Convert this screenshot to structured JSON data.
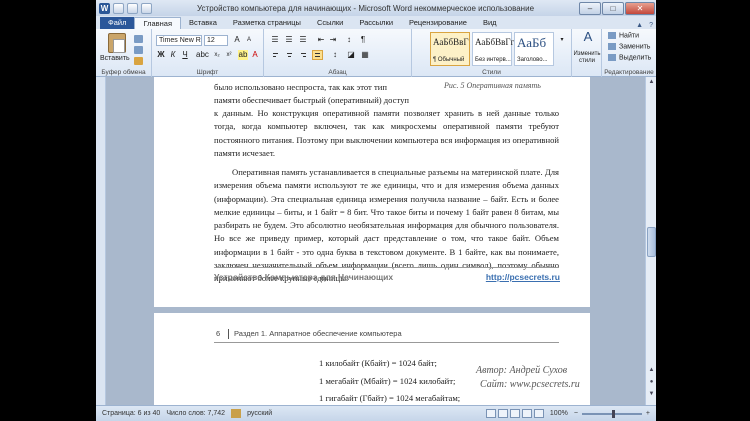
{
  "window": {
    "title": "Устройство компьютера для начинающих - Microsoft Word некоммерческое использование",
    "minimize": "–",
    "maximize": "□",
    "close": "✕"
  },
  "tabs": [
    "Файл",
    "Главная",
    "Вставка",
    "Разметка страницы",
    "Ссылки",
    "Рассылки",
    "Рецензирование",
    "Вид"
  ],
  "ribbon": {
    "clipboard": {
      "paste_label": "Вставить",
      "group_label": "Буфер обмена"
    },
    "font": {
      "font_name": "Times New Rc",
      "font_size": "12",
      "group_label": "Шрифт",
      "bold": "Ж",
      "italic": "К",
      "underline": "Ч"
    },
    "paragraph": {
      "group_label": "Абзац"
    },
    "styles": {
      "items": [
        {
          "sample": "АаБбВвГ",
          "name": "¶ Обычный"
        },
        {
          "sample": "АаБбВвГг",
          "name": "Без интерв..."
        },
        {
          "sample": "АаБб",
          "name": "Заголово..."
        }
      ],
      "change_label": "Изменить стили",
      "group_label": "Стили"
    },
    "editing": {
      "find": "Найти",
      "replace": "Заменить",
      "select": "Выделить",
      "group_label": "Редактирование"
    }
  },
  "document": {
    "page1": {
      "lines_top": [
        "было использовано неспроста, так как этот тип",
        "памяти обеспечивает быстрый (оперативный) доступ"
      ],
      "caption": "Рис. 5 Оперативная память",
      "para1": "к данным. Но конструкция оперативной памяти позволяет хранить в ней данные только тогда, когда компьютер включен, так как микросхемы оперативной памяти требуют постоянного питания. Поэтому при выключении компьютера вся информация из оперативной памяти исчезает.",
      "para2": "Оперативная память устанавливается в специальные разъемы на материнской плате. Для измерения объема памяти используют те же единицы, что и для измерения объема данных (информации). Эта специальная единица измерения получила название – байт. Есть и более мелкие единицы – биты, и 1 байт = 8 бит. Что такое биты и почему 1 байт равен 8 битам, мы разбирать не будем. Это абсолютно необязательная информация для обычного пользователя. Но все же приведу пример, который даст представление о том, что такое байт. Объем информации в 1 байт - это одна буква в текстовом документе. В 1 байте, как вы понимаете, заключен незначительный объем информации (всего лишь один символ), поэтому обычно применяют более крупные единицы.",
      "footer_left": "Устройство Компьютера для Начинающих",
      "footer_right": "http://pcsecrets.ru"
    },
    "page2": {
      "page_number": "6",
      "section": "Раздел 1. Аппаратное обеспечение компьютера",
      "units": [
        "1 килобайт (Кбайт) = 1024 байт;",
        "1 мегабайт (Мбайт) = 1024 килобайт;",
        "1 гигабайт (Гбайт) = 1024 мегабайтам;"
      ]
    }
  },
  "overlay": {
    "author": "Автор: Андрей Сухов",
    "site": "Сайт: www.pcsecrets.ru"
  },
  "status": {
    "page": "Страница: 6 из 40",
    "words": "Число слов: 7,742",
    "language": "русский",
    "zoom": "100%"
  }
}
